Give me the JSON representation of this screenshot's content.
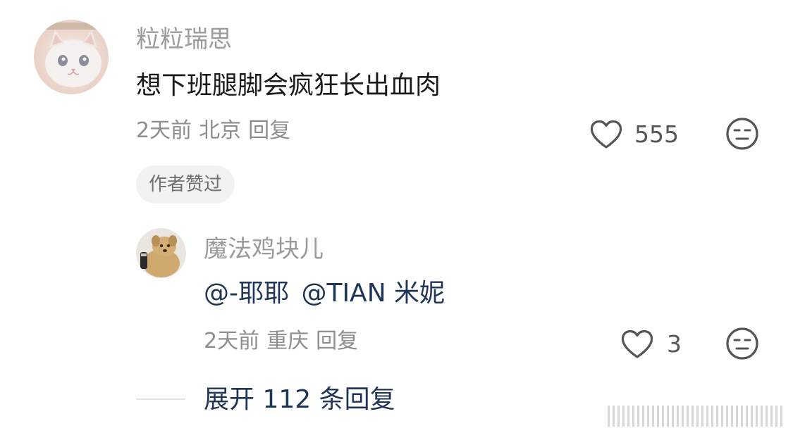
{
  "comment": {
    "username": "粒粒瑞思",
    "text": "想下班腿脚会疯狂长出血肉",
    "time": "2天前",
    "location": "北京",
    "reply_label": "回复",
    "like_count": "555",
    "author_liked_badge": "作者赞过",
    "icons": {
      "avatar": "cat-avatar",
      "like": "heart-outline-icon",
      "dislike": "neutral-face-icon"
    }
  },
  "reply": {
    "username": "魔法鸡块儿",
    "mention_1": "@-耶耶",
    "mention_2": "@TIAN 米妮",
    "time": "2天前",
    "location": "重庆",
    "reply_label": "回复",
    "like_count": "3",
    "icons": {
      "avatar": "dog-avatar",
      "like": "heart-outline-icon",
      "dislike": "neutral-face-icon"
    }
  },
  "expand": {
    "label": "展开 112 条回复"
  },
  "colors": {
    "username": "#9a9a9a",
    "body_text": "#1a1a1a",
    "link_blue": "#1f3558",
    "meta": "#8e8e8e",
    "badge_bg": "#f2f2f2"
  }
}
